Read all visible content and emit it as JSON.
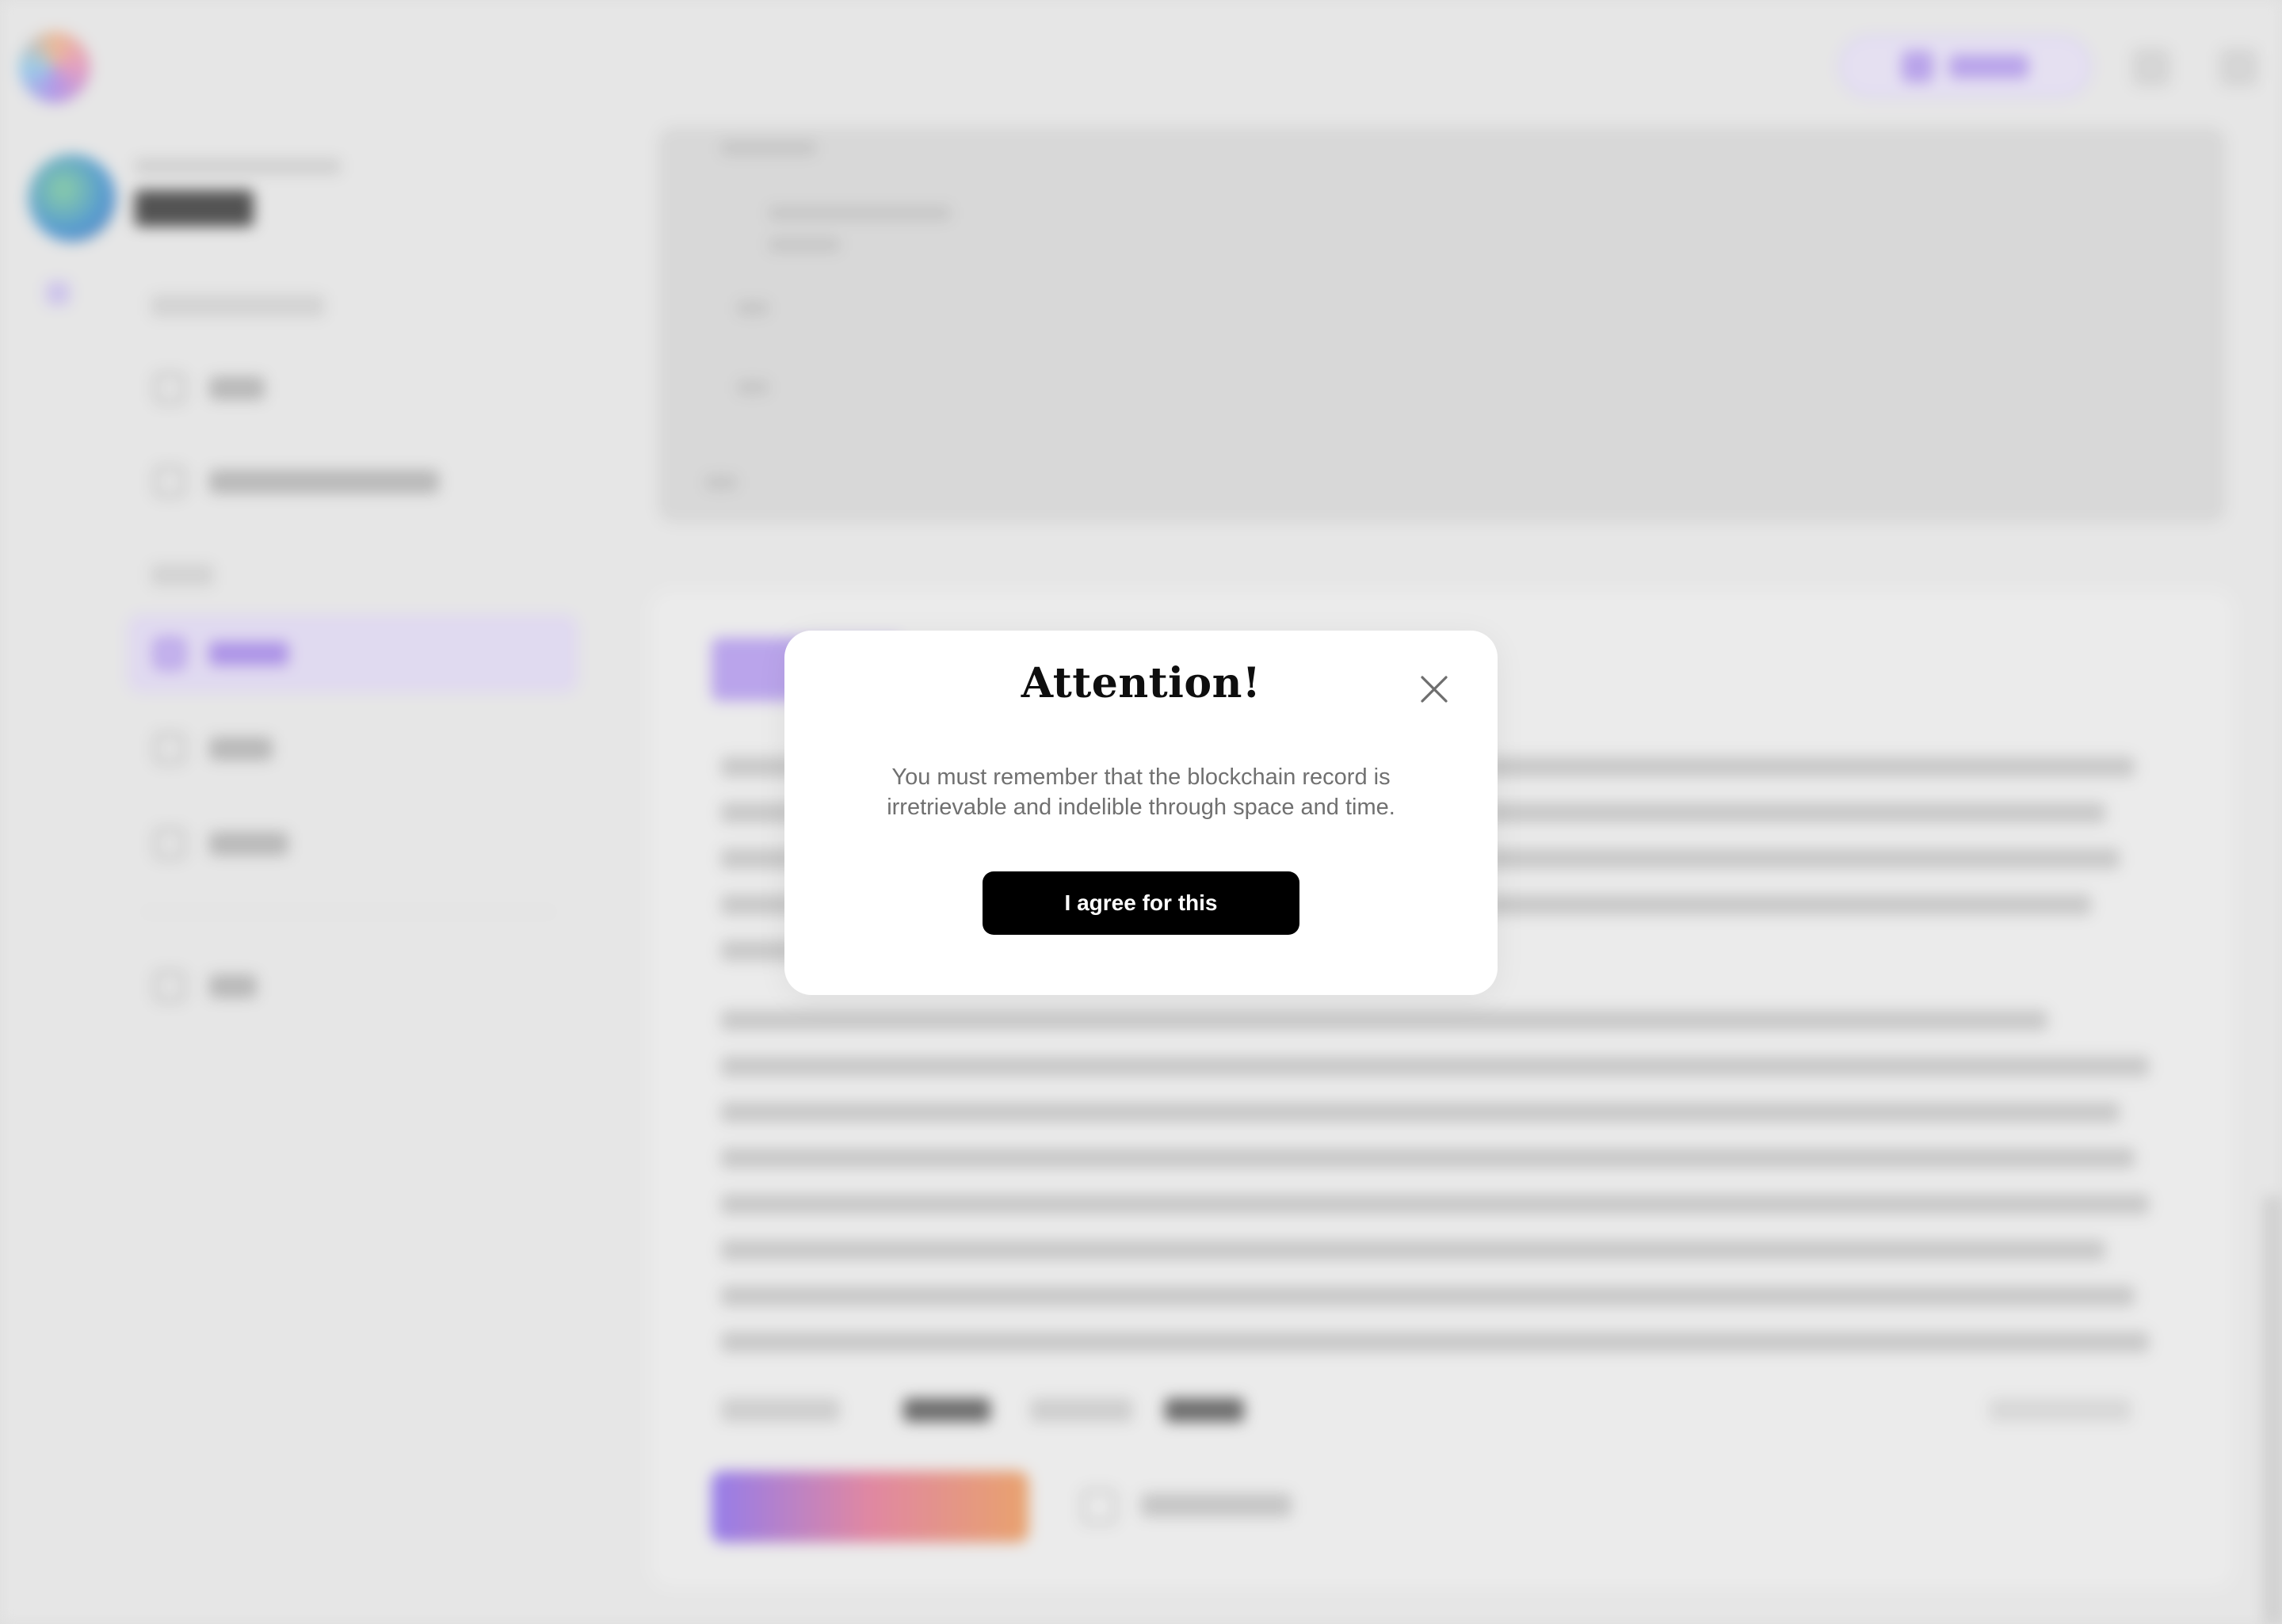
{
  "modal": {
    "title": "Attention!",
    "message": "You must remember that the blockchain record is irretrievable and indelible through space and time.",
    "confirm_label": "I agree for this",
    "close_icon": "close-icon"
  },
  "colors": {
    "accent": "#9b7df2",
    "button_bg": "#000000",
    "modal_bg": "#ffffff",
    "backdrop": "#e4e4e4"
  }
}
